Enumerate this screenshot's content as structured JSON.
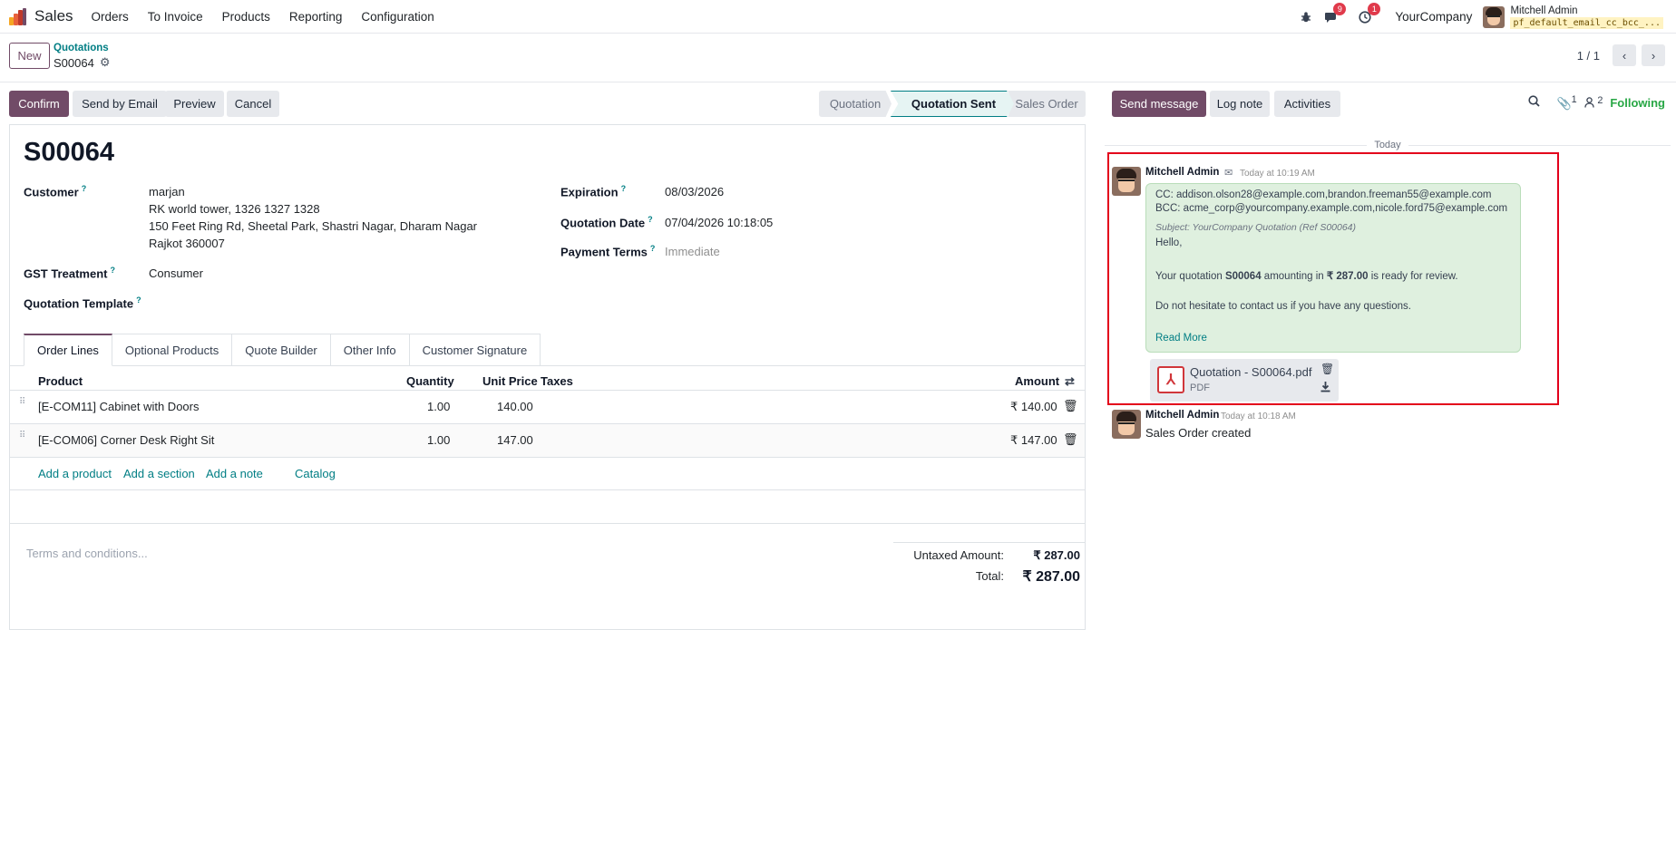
{
  "navbar": {
    "app_name": "Sales",
    "menu": [
      "Orders",
      "To Invoice",
      "Products",
      "Reporting",
      "Configuration"
    ],
    "messages_badge": "9",
    "activities_badge": "1",
    "company": "YourCompany",
    "user_name": "Mitchell Admin",
    "database": "pf_default_email_cc_bcc_..."
  },
  "control": {
    "new_label": "New",
    "breadcrumb": "Quotations",
    "record": "S00064",
    "pager": "1 / 1"
  },
  "statusbar": {
    "buttons": [
      "Confirm",
      "Send by Email",
      "Preview",
      "Cancel"
    ],
    "stages": [
      "Quotation",
      "Quotation Sent",
      "Sales Order"
    ],
    "active_stage": "Quotation Sent"
  },
  "form": {
    "title": "S00064",
    "customer_label": "Customer",
    "customer_lines": [
      "marjan",
      "RK world tower, 1326 1327 1328",
      "150 Feet Ring Rd, Sheetal Park, Shastri Nagar, Dharam Nagar",
      "Rajkot 360007"
    ],
    "gst_label": "GST Treatment",
    "gst_value": "Consumer",
    "template_label": "Quotation Template",
    "expiration_label": "Expiration",
    "expiration_value": "08/03/2026",
    "qdate_label": "Quotation Date",
    "qdate_value": "07/04/2026 10:18:05",
    "terms_label": "Payment Terms",
    "terms_placeholder": "Immediate",
    "tabs": [
      "Order Lines",
      "Optional Products",
      "Quote Builder",
      "Other Info",
      "Customer Signature"
    ],
    "columns": {
      "product": "Product",
      "quantity": "Quantity",
      "unit_price": "Unit Price",
      "taxes": "Taxes",
      "amount": "Amount"
    },
    "lines": [
      {
        "product": "[E-COM11] Cabinet with Doors",
        "quantity": "1.00",
        "unit_price": "140.00",
        "amount": "₹ 140.00"
      },
      {
        "product": "[E-COM06] Corner Desk Right Sit",
        "quantity": "1.00",
        "unit_price": "147.00",
        "amount": "₹ 147.00"
      }
    ],
    "add_links": [
      "Add a product",
      "Add a section",
      "Add a note",
      "Catalog"
    ],
    "terms_conditions_placeholder": "Terms and conditions...",
    "untaxed_label": "Untaxed Amount:",
    "untaxed_value": "₹ 287.00",
    "total_label": "Total:",
    "total_value": "₹ 287.00"
  },
  "chatter": {
    "buttons": [
      "Send message",
      "Log note",
      "Activities"
    ],
    "attachments_count": "1",
    "followers_count": "2",
    "following_label": "Following",
    "today_label": "Today",
    "message1": {
      "author": "Mitchell Admin",
      "time": "Today at 10:19 AM",
      "cc": "CC: addison.olson28@example.com,brandon.freeman55@example.com",
      "bcc": "BCC: acme_corp@yourcompany.example.com,nicole.ford75@example.com",
      "subject": "Subject: YourCompany Quotation (Ref S00064)",
      "greeting": "Hello,",
      "body_pre": "Your quotation ",
      "body_ref": "S00064",
      "body_mid": " amounting in ",
      "body_amount": "₹ 287.00",
      "body_post": " is ready for review.",
      "closing": "Do not hesitate to contact us if you have any questions.",
      "read_more": "Read More",
      "attachment_name": "Quotation - S00064.pdf",
      "attachment_type": "PDF"
    },
    "message2": {
      "author": "Mitchell Admin",
      "time": "Today at 10:18 AM",
      "body": "Sales Order created"
    }
  },
  "colors": {
    "primary": "#714b67",
    "link": "#017e84",
    "highlight": "#e3001b",
    "bubble": "#dff0df"
  }
}
